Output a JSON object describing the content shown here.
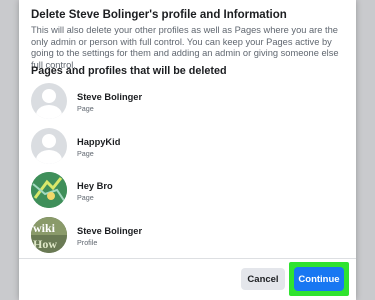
{
  "dialog": {
    "title": "Delete Steve Bolinger's profile and Information",
    "description": "This will also delete your other profiles as well as Pages where you are the only admin or person with full control. You can keep your Pages active by going to the settings for them and adding an admin or giving someone else full control.",
    "section_title": "Pages and profiles that will be deleted",
    "items": [
      {
        "name": "Steve Bolinger",
        "type": "Page"
      },
      {
        "name": "HappyKid",
        "type": "Page"
      },
      {
        "name": "Hey Bro",
        "type": "Page"
      },
      {
        "name": "Steve Bolinger",
        "type": "Profile"
      }
    ],
    "cancel_label": "Cancel",
    "continue_label": "Continue"
  },
  "colors": {
    "primary": "#1877f2",
    "highlight": "#2fe32f",
    "backdrop": "#c9cacd"
  }
}
